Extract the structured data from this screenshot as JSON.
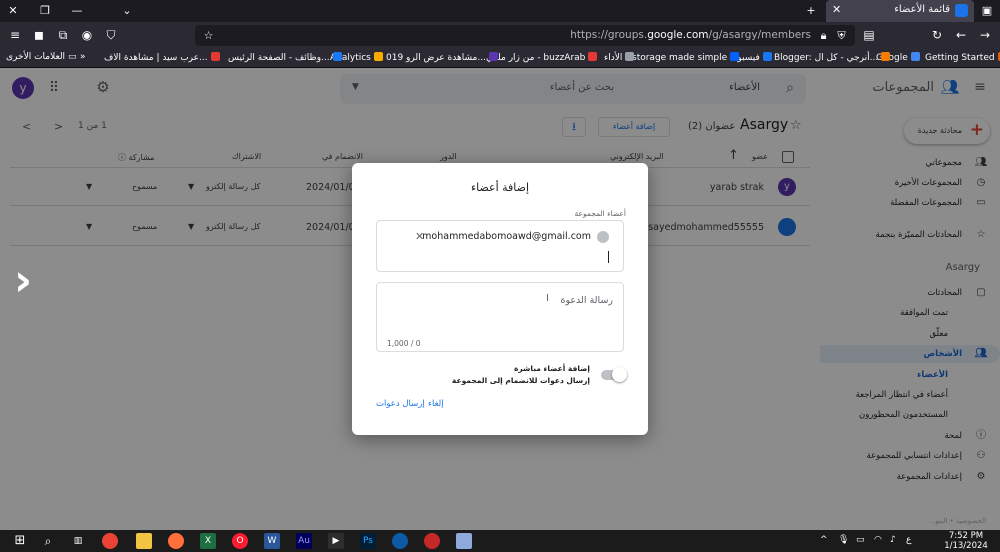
{
  "browser": {
    "tab_title": "قائمة الأعضاء",
    "url_prefix": "https://groups.",
    "url_domain": "google.com",
    "url_path": "/g/asargy/members",
    "bookmarks": [
      {
        "label": "Getting Started",
        "color": "#e66000"
      },
      {
        "label": "Google",
        "color": "#4285f4"
      },
      {
        "label": "Blogger: أنرجي - كل ال...",
        "color": "#f57c00"
      },
      {
        "label": "فيسبوك",
        "color": "#1877f2"
      },
      {
        "label": "storage made simple",
        "color": "#0061fe"
      },
      {
        "label": "الأداء",
        "color": "#9aa0a6"
      },
      {
        "label": "من زار ملفي - buzzArab",
        "color": "#e53935"
      },
      {
        "label": "مشاهدة عرض الرو 019...",
        "color": "#5e35b1"
      },
      {
        "label": "Analytics",
        "color": "#f9ab00"
      },
      {
        "label": "وظائف - الصفحة الرئيس...",
        "color": "#1877f2"
      },
      {
        "label": "عرب سيد | مشاهدة الاف...",
        "color": "#e53935"
      }
    ],
    "bookmarks_other": "العلامات الأخرى"
  },
  "header": {
    "avatar_letter": "y",
    "brand": "المجموعات",
    "search_scope": "الأعضاء",
    "search_placeholder": "بحث عن أعضاء"
  },
  "sidebar": {
    "new_conversation": "محادثة جديدة",
    "top_items": [
      {
        "label": "مجموعاتي",
        "icon": "people-icon"
      },
      {
        "label": "المجموعات الأخيرة",
        "icon": "clock-icon"
      },
      {
        "label": "المجموعات المفضلة",
        "icon": "folder-icon"
      },
      {
        "label": "المحادثات المميّزة بنجمة",
        "icon": "star-icon"
      }
    ],
    "group_heading": "Asargy",
    "group_items": [
      {
        "label": "المحادثات",
        "icon": "chat-icon",
        "sub": false,
        "active": false,
        "sub_active": false
      },
      {
        "label": "تمت الموافقة",
        "icon": "",
        "sub": true,
        "active": false,
        "sub_active": false
      },
      {
        "label": "معلّق",
        "icon": "",
        "sub": true,
        "active": false,
        "sub_active": false
      },
      {
        "label": "الأشخاص",
        "icon": "people-icon",
        "sub": false,
        "active": true,
        "sub_active": false
      },
      {
        "label": "الأعضاء",
        "icon": "",
        "sub": true,
        "active": false,
        "sub_active": true
      },
      {
        "label": "أعضاء في انتظار المراجعة",
        "icon": "",
        "sub": true,
        "active": false,
        "sub_active": false
      },
      {
        "label": "المستخدمون المحظورون",
        "icon": "",
        "sub": true,
        "active": false,
        "sub_active": false
      },
      {
        "label": "لمحة",
        "icon": "info-icon",
        "sub": false,
        "active": false,
        "sub_active": false
      },
      {
        "label": "إعدادات انتسابي للمجموعة",
        "icon": "member-settings-icon",
        "sub": false,
        "active": false,
        "sub_active": false
      },
      {
        "label": "إعدادات المجموعة",
        "icon": "gear-icon",
        "sub": false,
        "active": false,
        "sub_active": false
      }
    ]
  },
  "main": {
    "group_name": "Asargy",
    "members_count": "عضوان (2)",
    "add_members_button": "إضافة أعضاء",
    "pagination": "1 من 1",
    "columns": {
      "member": "عضو",
      "email": "البريد الإلكتروني",
      "role": "الدور",
      "joined": "الانضمام في",
      "subscription": "الاشتراك",
      "posting": "مشاركة"
    },
    "rows": [
      {
        "name": "yarab strak",
        "avatar": "y",
        "avatar_color": "#5e35b1",
        "joined": "2024/01/06",
        "subscription": "كل رسالة إلكترو",
        "posting": "مسموح"
      },
      {
        "name": "sayedmohammed55555",
        "avatar": "",
        "avatar_color": "#1a73e8",
        "joined": "2024/01/06",
        "subscription": "كل رسالة إلكترو",
        "posting": "مسموح"
      }
    ]
  },
  "dialog": {
    "title": "إضافة أعضاء",
    "members_label": "أعضاء المجموعة",
    "chip_email": "mohammedabomoawd@gmail.com",
    "invite_placeholder": "رسالة الدعوة",
    "char_counter": "1,000 / 0",
    "toggle_title": "إضافة أعضاء مباشرة",
    "toggle_desc": "إرسال دعوات للانضمام إلى المجموعة",
    "cancel": "إلغاء",
    "send": "إرسال دعوات"
  },
  "footer": {
    "privacy": "الخصوصية • البنو..."
  },
  "taskbar": {
    "time": "7:52 PM",
    "date": "1/13/2024",
    "lang": "ع"
  }
}
